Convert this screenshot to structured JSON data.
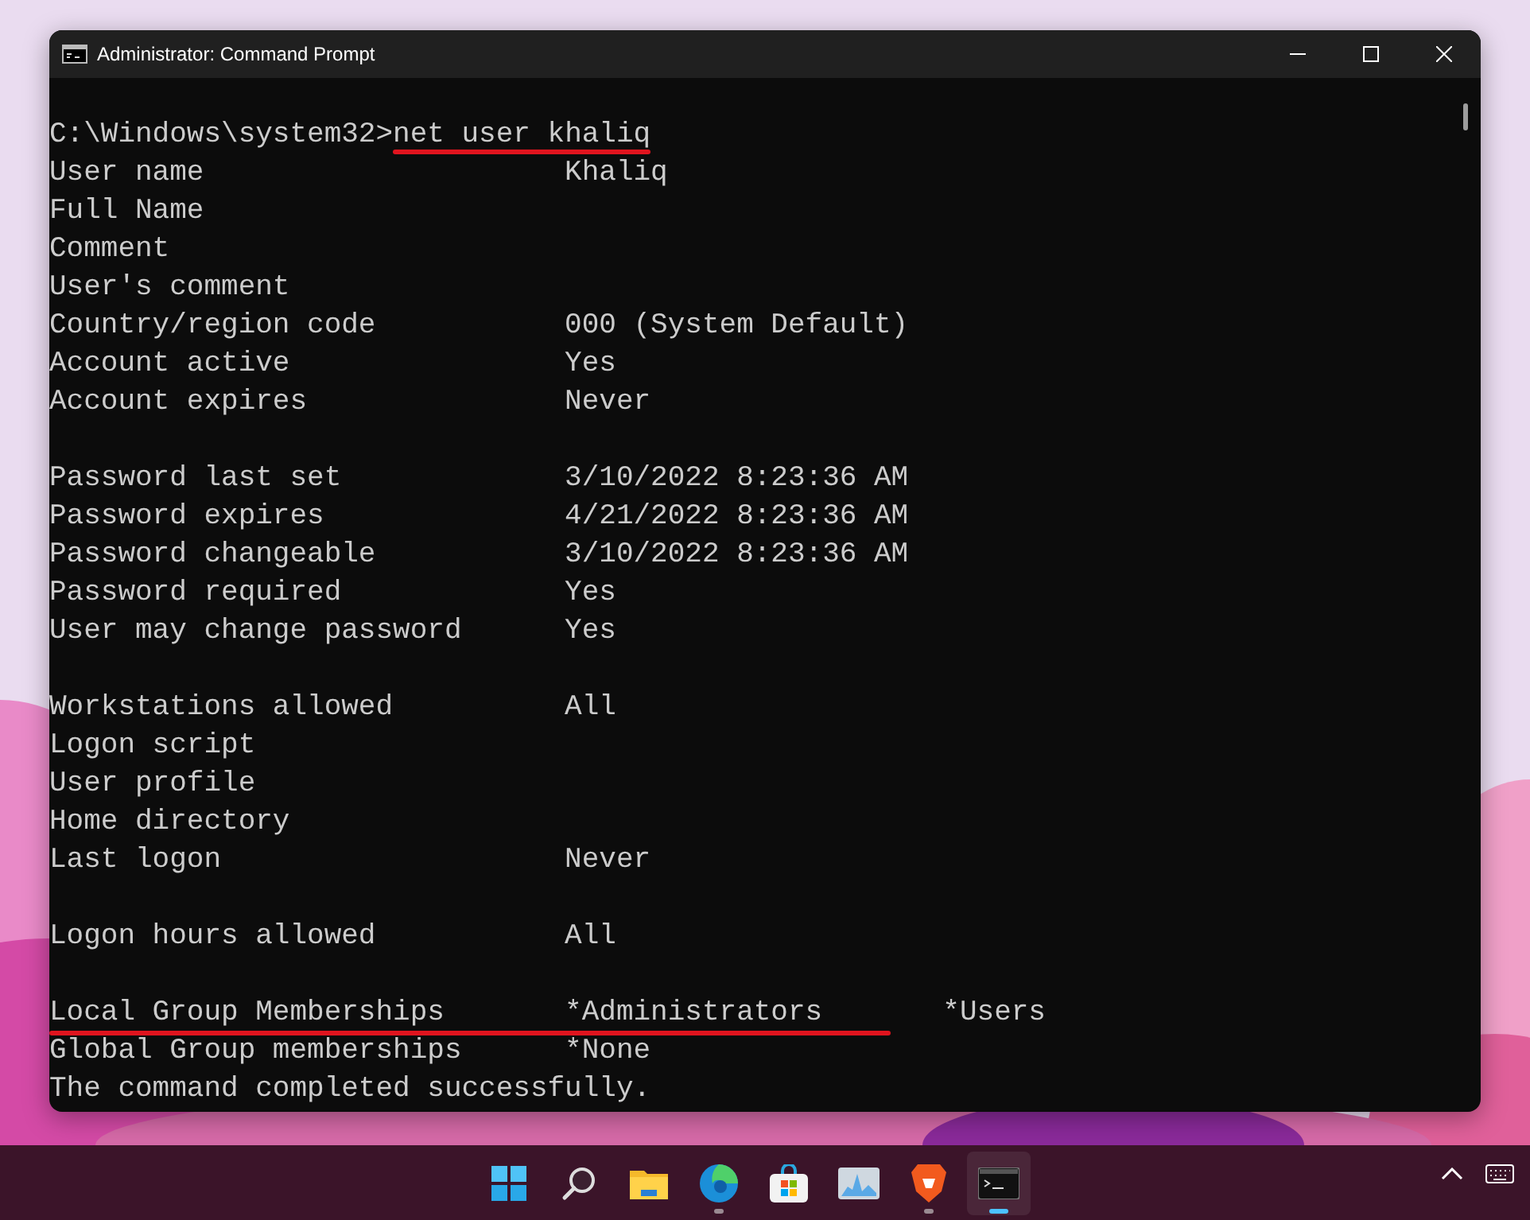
{
  "window": {
    "title": "Administrator: Command Prompt"
  },
  "console": {
    "lines": [
      {
        "kind": "command",
        "prompt": "C:\\Windows\\system32>",
        "command": "net user khaliq",
        "underlined": true
      },
      {
        "kind": "field",
        "label": "User name",
        "value": "Khaliq",
        "underlined": false
      },
      {
        "kind": "field",
        "label": "Full Name",
        "underlined": false
      },
      {
        "kind": "field",
        "label": "Comment",
        "underlined": false
      },
      {
        "kind": "field",
        "label": "User's comment",
        "underlined": false
      },
      {
        "kind": "field",
        "label": "Country/region code",
        "value": "000 (System Default)",
        "underlined": false
      },
      {
        "kind": "field",
        "label": "Account active",
        "value": "Yes",
        "underlined": false
      },
      {
        "kind": "field",
        "label": "Account expires",
        "value": "Never",
        "underlined": false
      },
      {
        "kind": "blank"
      },
      {
        "kind": "field",
        "label": "Password last set",
        "value": "3/10/2022 8:23:36 AM",
        "underlined": false
      },
      {
        "kind": "field",
        "label": "Password expires",
        "value": "4/21/2022 8:23:36 AM",
        "underlined": false
      },
      {
        "kind": "field",
        "label": "Password changeable",
        "value": "3/10/2022 8:23:36 AM",
        "underlined": false
      },
      {
        "kind": "field",
        "label": "Password required",
        "value": "Yes",
        "underlined": false
      },
      {
        "kind": "field",
        "label": "User may change password",
        "value": "Yes",
        "underlined": false
      },
      {
        "kind": "blank"
      },
      {
        "kind": "field",
        "label": "Workstations allowed",
        "value": "All",
        "underlined": false
      },
      {
        "kind": "field",
        "label": "Logon script",
        "underlined": false
      },
      {
        "kind": "field",
        "label": "User profile",
        "underlined": false
      },
      {
        "kind": "field",
        "label": "Home directory",
        "underlined": false
      },
      {
        "kind": "field",
        "label": "Last logon",
        "value": "Never",
        "underlined": false
      },
      {
        "kind": "blank"
      },
      {
        "kind": "field",
        "label": "Logon hours allowed",
        "value": "All",
        "underlined": false
      },
      {
        "kind": "blank"
      },
      {
        "kind": "field",
        "label": "Local Group Memberships",
        "value": "*Administrators",
        "value_2": "*Users",
        "underlined": true
      },
      {
        "kind": "field",
        "label": "Global Group memberships",
        "value": "*None",
        "underlined": false
      },
      {
        "kind": "message",
        "text": "The command completed successfully."
      }
    ]
  },
  "taskbar": {
    "apps": [
      {
        "kind": "start",
        "running": false,
        "selected": false
      },
      {
        "kind": "search",
        "running": false,
        "selected": false
      },
      {
        "kind": "files",
        "running": false,
        "selected": false
      },
      {
        "kind": "browser",
        "running": true,
        "selected": false
      },
      {
        "kind": "store",
        "running": false,
        "selected": false
      },
      {
        "kind": "monitor",
        "running": false,
        "selected": false
      },
      {
        "kind": "lion",
        "running": true,
        "selected": false
      },
      {
        "kind": "terminal",
        "running": true,
        "selected": true
      }
    ]
  }
}
